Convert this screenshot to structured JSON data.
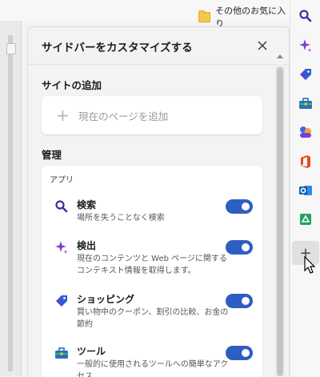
{
  "favorites_bar": {
    "folder_label": "その他のお気に入り"
  },
  "panel": {
    "title": "サイドバーをカスタマイズする",
    "add_section": {
      "title": "サイトの追加",
      "add_label": "現在のページを追加"
    },
    "manage_section": {
      "title": "管理",
      "apps_heading": "アプリ"
    },
    "apps": [
      {
        "name": "検索",
        "desc": "場所を失うことなく検索",
        "icon": "search-icon",
        "enabled": true
      },
      {
        "name": "検出",
        "desc": "現在のコンテンツと Web ページに関するコンテキスト情報を取得します。",
        "icon": "sparkle-icon",
        "enabled": true
      },
      {
        "name": "ショッピング",
        "desc": "買い物中のクーポン、割引の比較、お金の節約",
        "icon": "shopping-tag-icon",
        "enabled": true
      },
      {
        "name": "ツール",
        "desc": "一般的に使用されるツールへの簡単なアクセス",
        "icon": "toolbox-icon",
        "enabled": true
      }
    ]
  },
  "sidebar": {
    "icons": [
      "search-icon",
      "sparkle-icon",
      "shopping-tag-icon",
      "toolbox-icon",
      "games-icon",
      "office-icon",
      "outlook-icon",
      "drop-icon",
      "add-icon"
    ],
    "add_label": "+"
  },
  "colors": {
    "toggle_on": "#2f5ec2",
    "accent": "#2f5ec2"
  }
}
